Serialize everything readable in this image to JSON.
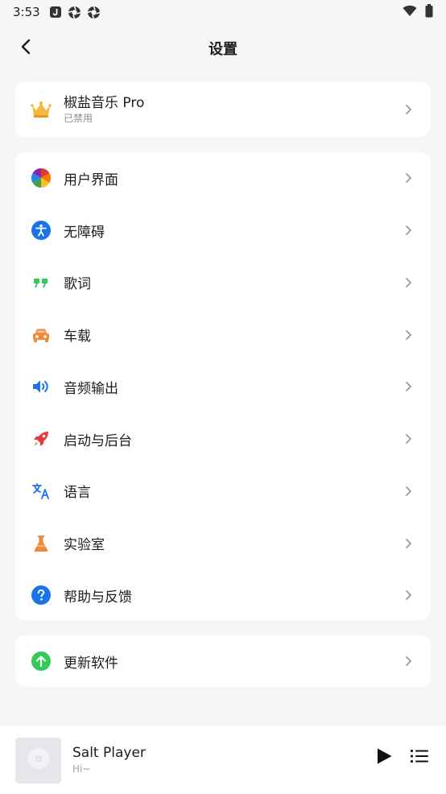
{
  "status_bar": {
    "time": "3:53",
    "left_icons": [
      "j-app-icon",
      "aperture-icon",
      "aperture-icon"
    ],
    "right_icons": [
      "wifi-icon",
      "battery-icon"
    ]
  },
  "header": {
    "title": "设置",
    "back_icon": "chevron-left-icon"
  },
  "pro": {
    "title": "椒盐音乐 Pro",
    "subtitle": "已禁用",
    "icon": "crown-icon"
  },
  "menu": {
    "items": [
      {
        "label": "用户界面",
        "icon": "color-wheel-icon"
      },
      {
        "label": "无障碍",
        "icon": "accessibility-icon"
      },
      {
        "label": "歌词",
        "icon": "quote-icon"
      },
      {
        "label": "车载",
        "icon": "car-icon"
      },
      {
        "label": "音频输出",
        "icon": "speaker-icon"
      },
      {
        "label": "启动与后台",
        "icon": "rocket-icon"
      },
      {
        "label": "语言",
        "icon": "translate-icon"
      },
      {
        "label": "实验室",
        "icon": "flask-icon"
      },
      {
        "label": "帮助与反馈",
        "icon": "help-icon"
      }
    ]
  },
  "update": {
    "label": "更新软件",
    "icon": "update-arrow-icon"
  },
  "player": {
    "title": "Salt Player",
    "subtitle": "Hi~",
    "play_icon": "play-icon",
    "queue_icon": "queue-list-icon"
  },
  "colors": {
    "background": "#f5f6f8",
    "card": "#ffffff",
    "text": "#1d1d1f",
    "secondary_text": "#8e8e93",
    "accent_blue": "#1a73e8",
    "accent_green": "#34c759",
    "accent_orange": "#f08a3c",
    "accent_red": "#e53935"
  }
}
